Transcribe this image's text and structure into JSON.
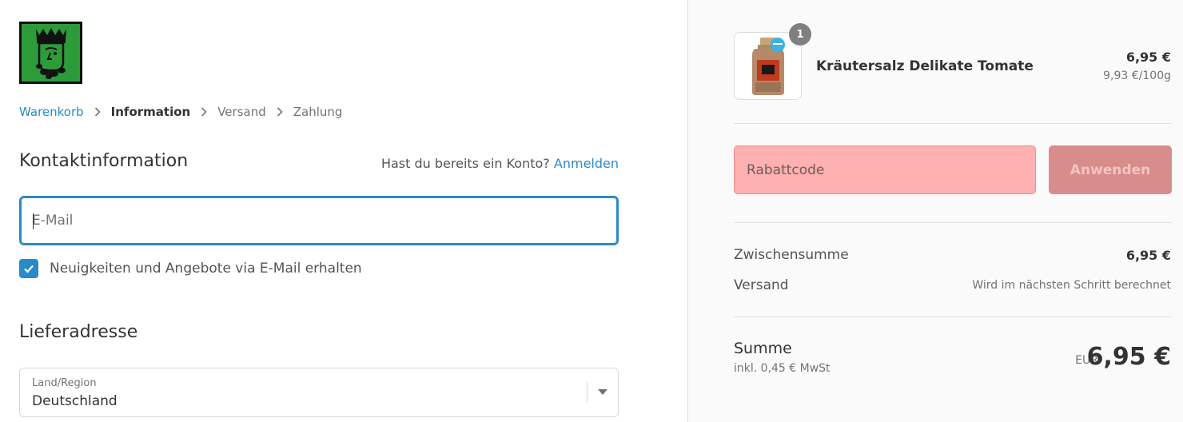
{
  "brand": {
    "logo_icon": "king-crest-logo",
    "logo_color": "#2e9b3a"
  },
  "breadcrumb": {
    "items": [
      {
        "label": "Warenkorb",
        "state": "link"
      },
      {
        "label": "Information",
        "state": "current"
      },
      {
        "label": "Versand",
        "state": "inactive"
      },
      {
        "label": "Zahlung",
        "state": "inactive"
      }
    ],
    "separator_icon": "chevron-right-icon"
  },
  "contact": {
    "title": "Kontaktinformation",
    "login_prompt": "Hast du bereits ein Konto?",
    "login_link": "Anmelden",
    "email_placeholder": "E-Mail",
    "email_value": "",
    "newsletter_label": "Neuigkeiten und Angebote via E-Mail erhalten",
    "newsletter_checked": true
  },
  "shipping": {
    "title": "Lieferadresse",
    "country_label": "Land/Region",
    "country_value": "Deutschland"
  },
  "cart": {
    "item": {
      "quantity": "1",
      "name": "Kräutersalz Delikate Tomate",
      "price": "6,95 €",
      "unit_price": "9,93 €/100g"
    },
    "discount": {
      "placeholder": "Rabattcode",
      "apply_label": "Anwenden"
    },
    "subtotal_label": "Zwischensumme",
    "subtotal_value": "6,95 €",
    "shipping_label": "Versand",
    "shipping_value": "Wird im nächsten Schritt berechnet",
    "total_label": "Summe",
    "tax_note": "inkl. 0,45 € MwSt",
    "currency": "EUR",
    "total_value": "6,95 €"
  },
  "colors": {
    "accent": "#2a8ac8",
    "error_field": "#ffb0b0",
    "apply_button": "#d98c8c"
  }
}
